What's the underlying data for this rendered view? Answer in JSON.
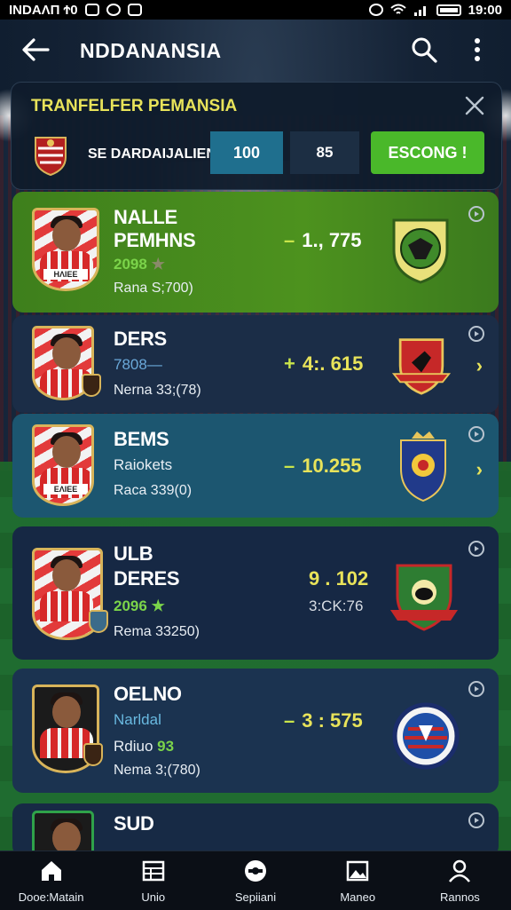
{
  "status_bar": {
    "carrier": "INDAΛΠ Ϯ0",
    "time": "19:00"
  },
  "app_bar": {
    "title": "NDDANANSIA",
    "back_icon": "arrow-left-icon",
    "search_icon": "search-icon",
    "more_icon": "more-vert-icon"
  },
  "filter_panel": {
    "title": "TRANFELFER PEMANSIA",
    "label": "SE DARDAIJALIEN",
    "field_1": "100",
    "field_2": "85",
    "button": "ESCONG !",
    "close_icon": "close-icon"
  },
  "players": [
    {
      "name_line1": "NALLE",
      "name_line2": "PEMHNS",
      "stat": "2098",
      "stat_icon": "star-icon",
      "detail": "Rana S;700)",
      "sign": "–",
      "value": "1., 775"
    },
    {
      "name_line1": "DERS",
      "stat": "7808—",
      "detail": "Nerna 33;(78)",
      "sign": "+",
      "value": "4:. 615"
    },
    {
      "name_line1": "BEMS",
      "stat": "Raiokets",
      "detail": "Raca 339(0)",
      "sign": "–",
      "value": "10.255"
    },
    {
      "name_line1": "ULB",
      "name_line2": "DERES",
      "stat": "2096",
      "stat_icon": "star-icon",
      "detail": "Rema 33250)",
      "value_a": "9 . 102",
      "value_b": "3:CK:76"
    },
    {
      "name_line1": "OELNO",
      "stat": "Narldal",
      "stat2_prefix": "Rdiuo",
      "stat2_value": "93",
      "detail": "Nema 3;(780)",
      "sign": "–",
      "value": "3 : 575"
    },
    {
      "name_line1": "SUD"
    }
  ],
  "bottom_nav": [
    {
      "label": "Dooe:Matain",
      "icon": "home-icon"
    },
    {
      "label": "Unio",
      "icon": "list-icon"
    },
    {
      "label": "Sepiiani",
      "icon": "whistle-icon"
    },
    {
      "label": "Maneo",
      "icon": "image-icon"
    },
    {
      "label": "Rannos",
      "icon": "person-icon"
    }
  ],
  "colors": {
    "accent_green": "#4ab82a",
    "accent_yellow": "#e8e35a",
    "card_highlight": "#4d921e",
    "filter_selected": "#1f6f8e"
  }
}
